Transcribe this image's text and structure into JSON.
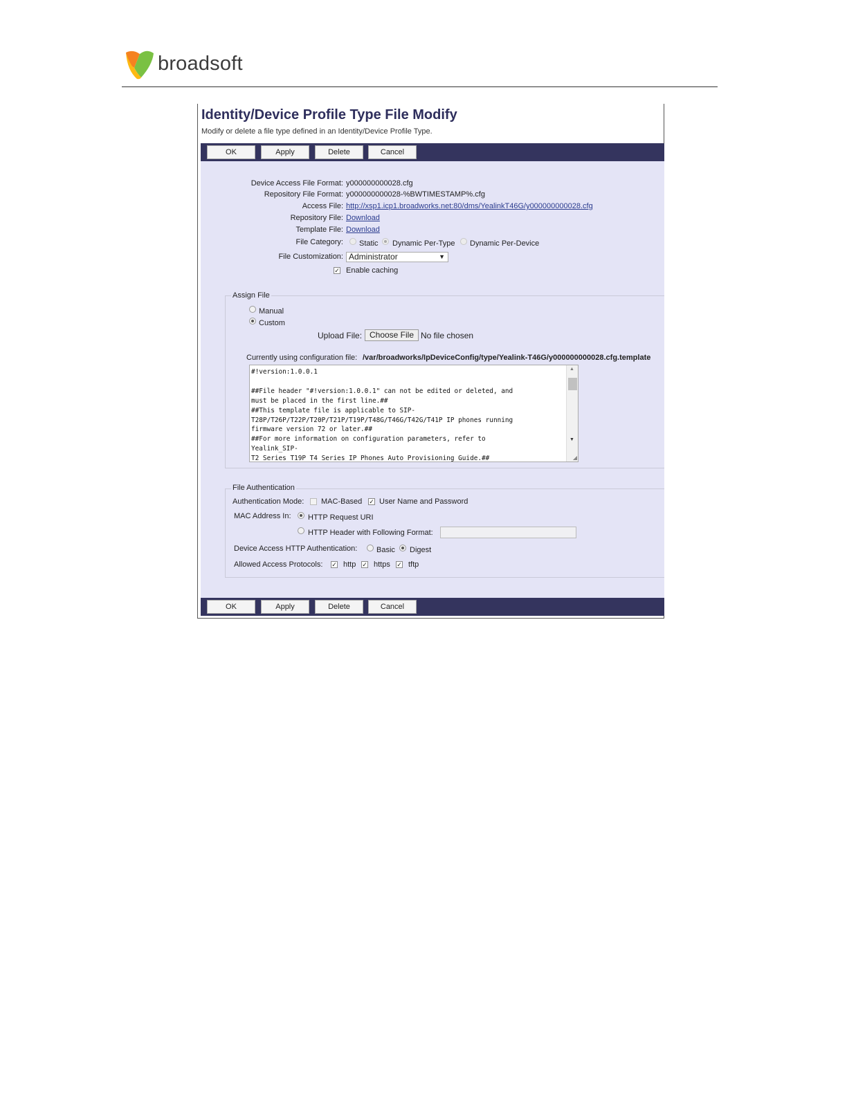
{
  "brand": {
    "name": "broadsoft",
    "colors": {
      "orange": "#f58220",
      "yellow": "#fdb913",
      "green": "#7ac143",
      "text": "#3c3c3c"
    }
  },
  "page": {
    "title": "Identity/Device Profile Type File Modify",
    "description": "Modify or delete a file type defined in an Identity/Device Profile Type."
  },
  "buttons": {
    "ok": "OK",
    "apply": "Apply",
    "delete": "Delete",
    "cancel": "Cancel"
  },
  "fields": {
    "device_access_label": "Device Access File Format:",
    "device_access_value": "y000000000028.cfg",
    "repository_format_label": "Repository File Format:",
    "repository_format_value": "y000000000028-%BWTIMESTAMP%.cfg",
    "access_file_label": "Access File:",
    "access_file_value": "http://xsp1.icp1.broadworks.net:80/dms/YealinkT46G/y000000000028.cfg",
    "repository_file_label": "Repository File:",
    "repository_file_value": "Download",
    "template_file_label": "Template File:",
    "template_file_value": "Download",
    "file_category_label": "File Category:",
    "file_category_options": [
      "Static",
      "Dynamic Per-Type",
      "Dynamic Per-Device"
    ],
    "file_category_selected": "Dynamic Per-Type",
    "file_customization_label": "File Customization:",
    "file_customization_value": "Administrator",
    "enable_caching_label": "Enable caching",
    "enable_caching_checked": true
  },
  "assign_file": {
    "legend": "Assign File",
    "manual_label": "Manual",
    "custom_label": "Custom",
    "selected": "Custom",
    "upload_label": "Upload File:",
    "choose_button": "Choose File",
    "no_file": "No file chosen",
    "current_label": "Currently using configuration file:",
    "current_path": "/var/broadworks/IpDeviceConfig/type/Yealink-T46G/y000000000028.cfg.template",
    "content": "#!version:1.0.0.1\n\n##File header \"#!version:1.0.0.1\" can not be edited or deleted, and\nmust be placed in the first line.##\n##This template file is applicable to SIP-\nT28P/T26P/T22P/T20P/T21P/T19P/T48G/T46G/T42G/T41P IP phones running\nfirmware version 72 or later.##\n##For more information on configuration parameters, refer to\nYealink_SIP-\nT2_Series_T19P_T4_Series_IP_Phones_Auto_Provisioning_Guide.##"
  },
  "file_auth": {
    "legend": "File Authentication",
    "auth_mode_label": "Authentication Mode:",
    "mac_based_label": "MAC-Based",
    "mac_based_checked": false,
    "user_pass_label": "User Name and Password",
    "user_pass_checked": true,
    "mac_in_label": "MAC Address In:",
    "http_request_uri_label": "HTTP Request URI",
    "http_header_label": "HTTP Header with Following Format:",
    "mac_in_selected": "HTTP Request URI",
    "http_auth_label": "Device Access HTTP Authentication:",
    "basic_label": "Basic",
    "digest_label": "Digest",
    "http_auth_selected": "Digest",
    "protocols_label": "Allowed Access Protocols:",
    "protocols": [
      {
        "label": "http",
        "checked": true
      },
      {
        "label": "https",
        "checked": true
      },
      {
        "label": "tftp",
        "checked": true
      }
    ]
  }
}
